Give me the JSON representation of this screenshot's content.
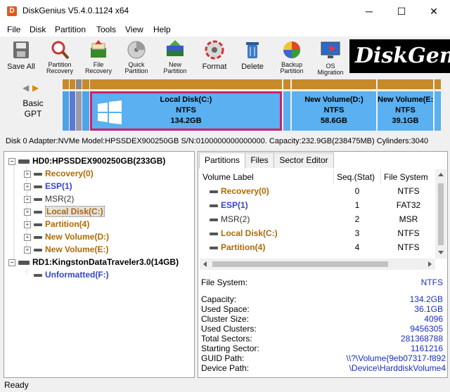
{
  "window": {
    "title": "DiskGenius V5.4.0.1124 x64",
    "icon_glyph": "D",
    "minimize": "─",
    "maximize": "☐",
    "close": "✕"
  },
  "menu": [
    "File",
    "Disk",
    "Partition",
    "Tools",
    "View",
    "Help"
  ],
  "toolbar": {
    "save_all": "Save All",
    "partition_recovery": [
      "Partition",
      "Recovery"
    ],
    "file_recovery": [
      "File",
      "Recovery"
    ],
    "quick_partition": [
      "Quick",
      "Partition"
    ],
    "new_partition": [
      "New",
      "Partition"
    ],
    "format": "Format",
    "delete": "Delete",
    "backup_partition": [
      "Backup",
      "Partition"
    ],
    "os_migration": "OS Migration",
    "brand": "DiskGenius"
  },
  "diskmap": {
    "nav_left": "◀",
    "nav_right": "▶",
    "disk_type": [
      "Basic",
      "GPT"
    ],
    "partitions": [
      {
        "name": "Local Disk(C:)",
        "fs": "NTFS",
        "size": "134.2GB"
      },
      {
        "name": "New Volume(D:)",
        "fs": "NTFS",
        "size": "58.6GB"
      },
      {
        "name": "New Volume(E:)",
        "fs": "NTFS",
        "size": "39.1GB"
      }
    ]
  },
  "disk_info": "Disk 0 Adapter:NVMe  Model:HPSSDEX900250GB  S/N:0100000000000000.  Capacity:232.9GB(238475MB)  Cylinders:3040",
  "tree": {
    "disk0": "HD0:HPSSDEX900250GB(233GB)",
    "disk0_parts": [
      {
        "label": "Recovery(0)",
        "color": "#b06a00",
        "expandable": true
      },
      {
        "label": "ESP(1)",
        "color": "#3344d0",
        "expandable": true
      },
      {
        "label": "MSR(2)",
        "color": "#333333",
        "expandable": true
      },
      {
        "label": "Local Disk(C:)",
        "color": "#b06a00",
        "expandable": true
      },
      {
        "label": "Partition(4)",
        "color": "#b06a00",
        "expandable": true
      },
      {
        "label": "New Volume(D:)",
        "color": "#b06a00",
        "expandable": true
      },
      {
        "label": "New Volume(E:)",
        "color": "#b06a00",
        "expandable": true
      }
    ],
    "disk1": "RD1:KingstonDataTraveler3.0(14GB)",
    "disk1_parts": [
      {
        "label": "Unformatted(F:)",
        "color": "#3344d0"
      }
    ]
  },
  "tabs": [
    "Partitions",
    "Files",
    "Sector Editor"
  ],
  "table": {
    "headers": [
      "Volume Label",
      "Seq.(Stat)",
      "File System"
    ],
    "rows": [
      {
        "label": "Recovery(0)",
        "seq": "0",
        "fs": "NTFS",
        "color": "#b06a00"
      },
      {
        "label": "ESP(1)",
        "seq": "1",
        "fs": "FAT32",
        "color": "#3344d0"
      },
      {
        "label": "MSR(2)",
        "seq": "2",
        "fs": "MSR",
        "color": "#333333"
      },
      {
        "label": "Local Disk(C:)",
        "seq": "3",
        "fs": "NTFS",
        "color": "#b06a00"
      },
      {
        "label": "Partition(4)",
        "seq": "4",
        "fs": "NTFS",
        "color": "#b06a00"
      }
    ]
  },
  "details": {
    "file_system": {
      "label": "File System:",
      "value": "NTFS"
    },
    "rows": [
      {
        "label": "Capacity:",
        "value": "134.2GB"
      },
      {
        "label": "Used Space:",
        "value": "36.1GB"
      },
      {
        "label": "Cluster Size:",
        "value": "4096"
      },
      {
        "label": "Used Clusters:",
        "value": "9456305"
      },
      {
        "label": "Total Sectors:",
        "value": "281368788"
      },
      {
        "label": "Starting Sector:",
        "value": "1161216"
      },
      {
        "label": "GUID Path:",
        "value": "\\\\?\\Volume{9eb07317-f892"
      },
      {
        "label": "Device Path:",
        "value": "\\Device\\HarddiskVolume4"
      }
    ]
  },
  "status": "Ready"
}
